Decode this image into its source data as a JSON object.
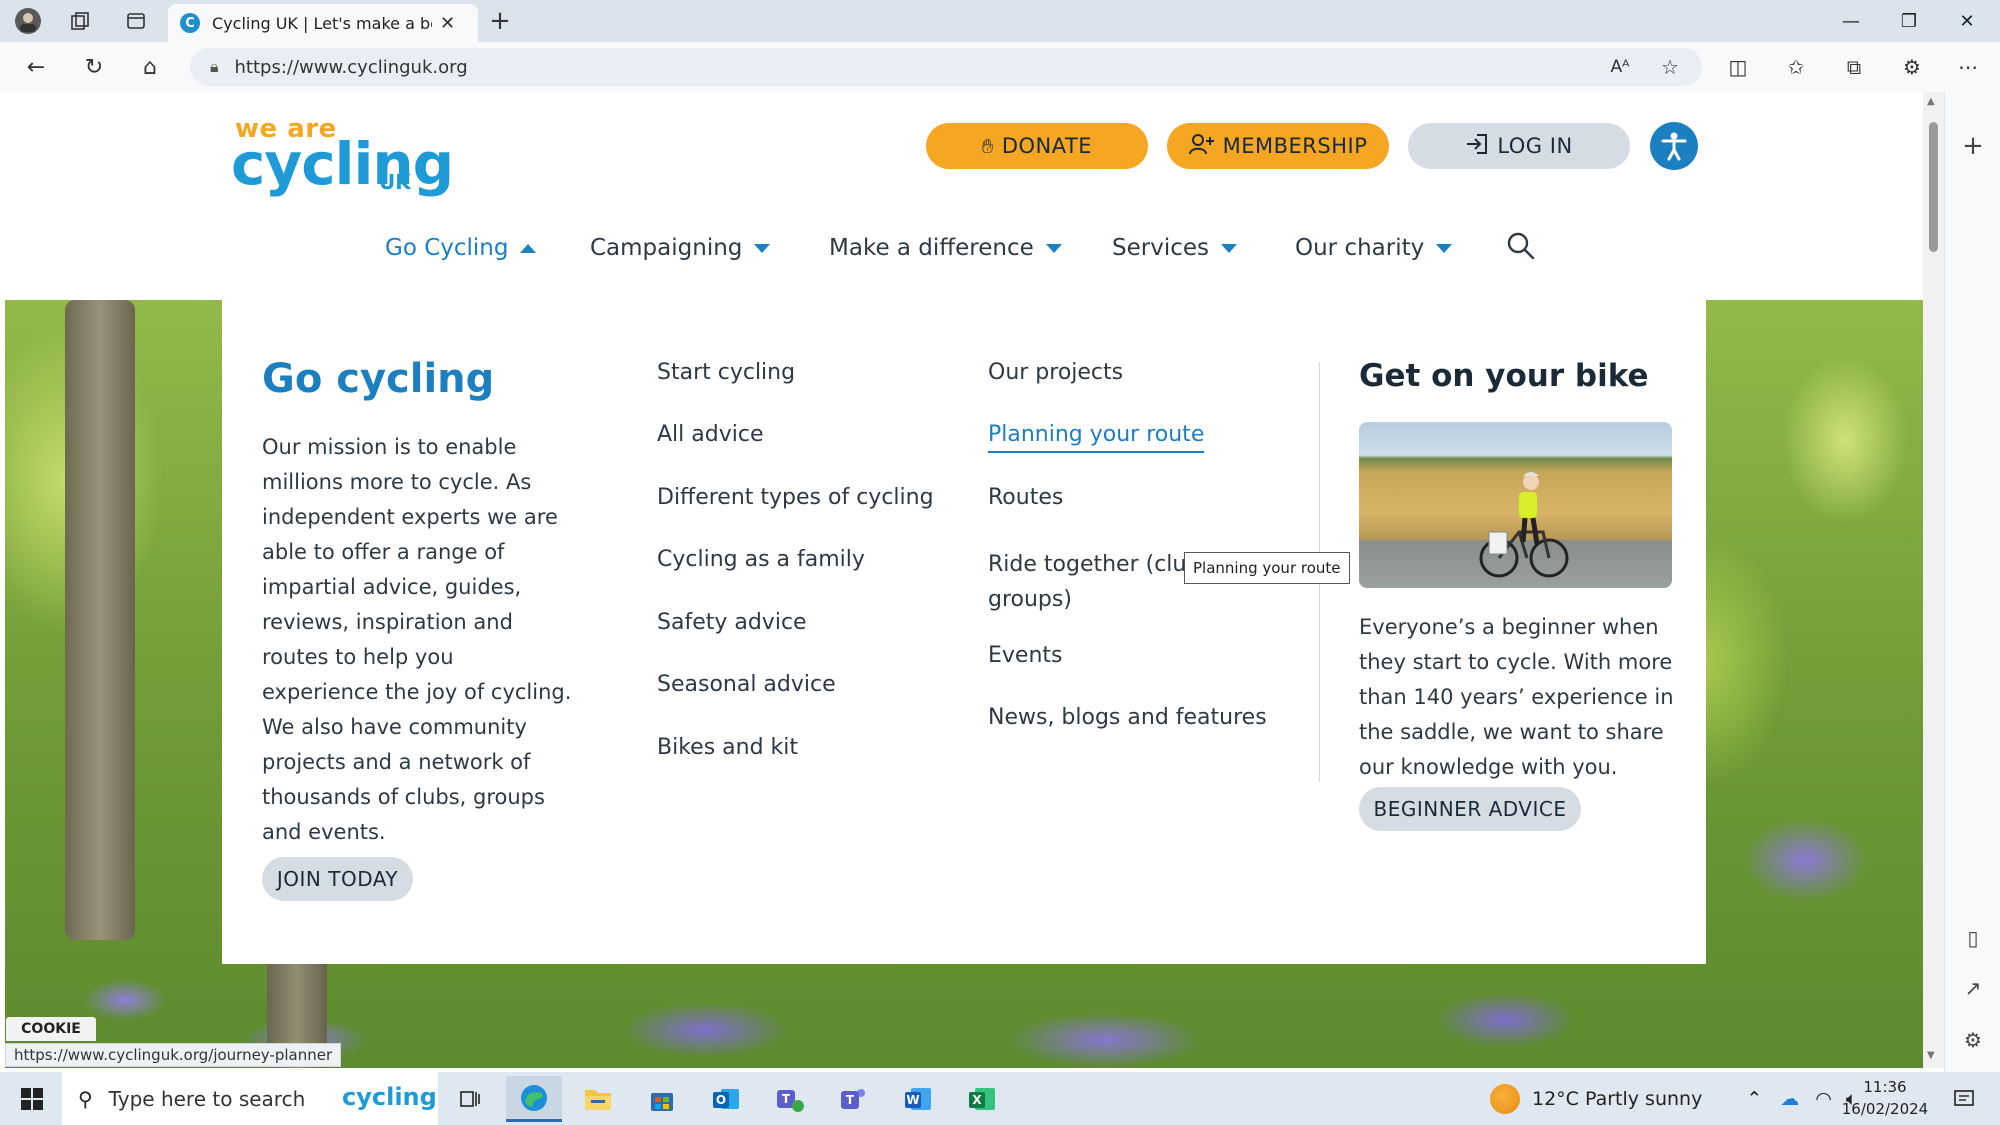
{
  "browser": {
    "tab_title": "Cycling UK | Let's make a better w",
    "new_tab_symbol": "+",
    "url": "https://www.cyclinguk.org",
    "window_controls": [
      "minimize-icon",
      "restore-icon",
      "close-icon"
    ]
  },
  "site": {
    "logo": {
      "top": "we are",
      "main": "cycling",
      "sub": "UK"
    },
    "header_buttons": {
      "donate": "DONATE",
      "membership": "MEMBERSHIP",
      "login": "LOG IN"
    },
    "nav": {
      "items": [
        {
          "label": "Go Cycling",
          "active": true
        },
        {
          "label": "Campaigning",
          "active": false
        },
        {
          "label": "Make a difference",
          "active": false
        },
        {
          "label": "Services",
          "active": false
        },
        {
          "label": "Our charity",
          "active": false
        }
      ]
    },
    "mega_menu": {
      "title": "Go cycling",
      "description": "Our mission is to enable millions more to cycle. As independent experts we are able to offer a range of impartial advice, guides, reviews, inspiration and routes to help you experience the joy of cycling. We also have community projects and a network of thousands of clubs, groups and events.",
      "join_button": "JOIN TODAY",
      "column1": [
        "Start cycling",
        "All advice",
        "Different types of cycling",
        "Cycling as a family",
        "Safety advice",
        "Seasonal advice",
        "Bikes and kit"
      ],
      "column2": [
        "Our projects",
        "Planning your route",
        "Routes",
        "Ride together (clubs and groups)",
        "Events",
        "News, blogs and features"
      ],
      "promo": {
        "title": "Get on your bike",
        "description": "Everyone’s a beginner when they start to cycle. With more than 140 years’ experience in the saddle, we want to share our knowledge with you.",
        "button": "BEGINNER ADVICE"
      },
      "tooltip": "Planning your route"
    },
    "cookie_tab": "COOKIE",
    "status_url": "https://www.cyclinguk.org/journey-planner"
  },
  "taskbar": {
    "search_placeholder": "Type here to search",
    "search_badge": "cycling",
    "weather": "12°C  Partly sunny",
    "time": "11:36",
    "date": "16/02/2024",
    "apps": [
      "task-view-icon",
      "edge-icon",
      "file-explorer-icon",
      "store-icon",
      "outlook-icon",
      "teams-icon",
      "teams-chat-icon",
      "word-icon",
      "excel-icon"
    ]
  },
  "colors": {
    "brand_blue": "#1b7fc0",
    "brand_orange": "#f5a623",
    "pill_grey": "#d6dce3"
  }
}
